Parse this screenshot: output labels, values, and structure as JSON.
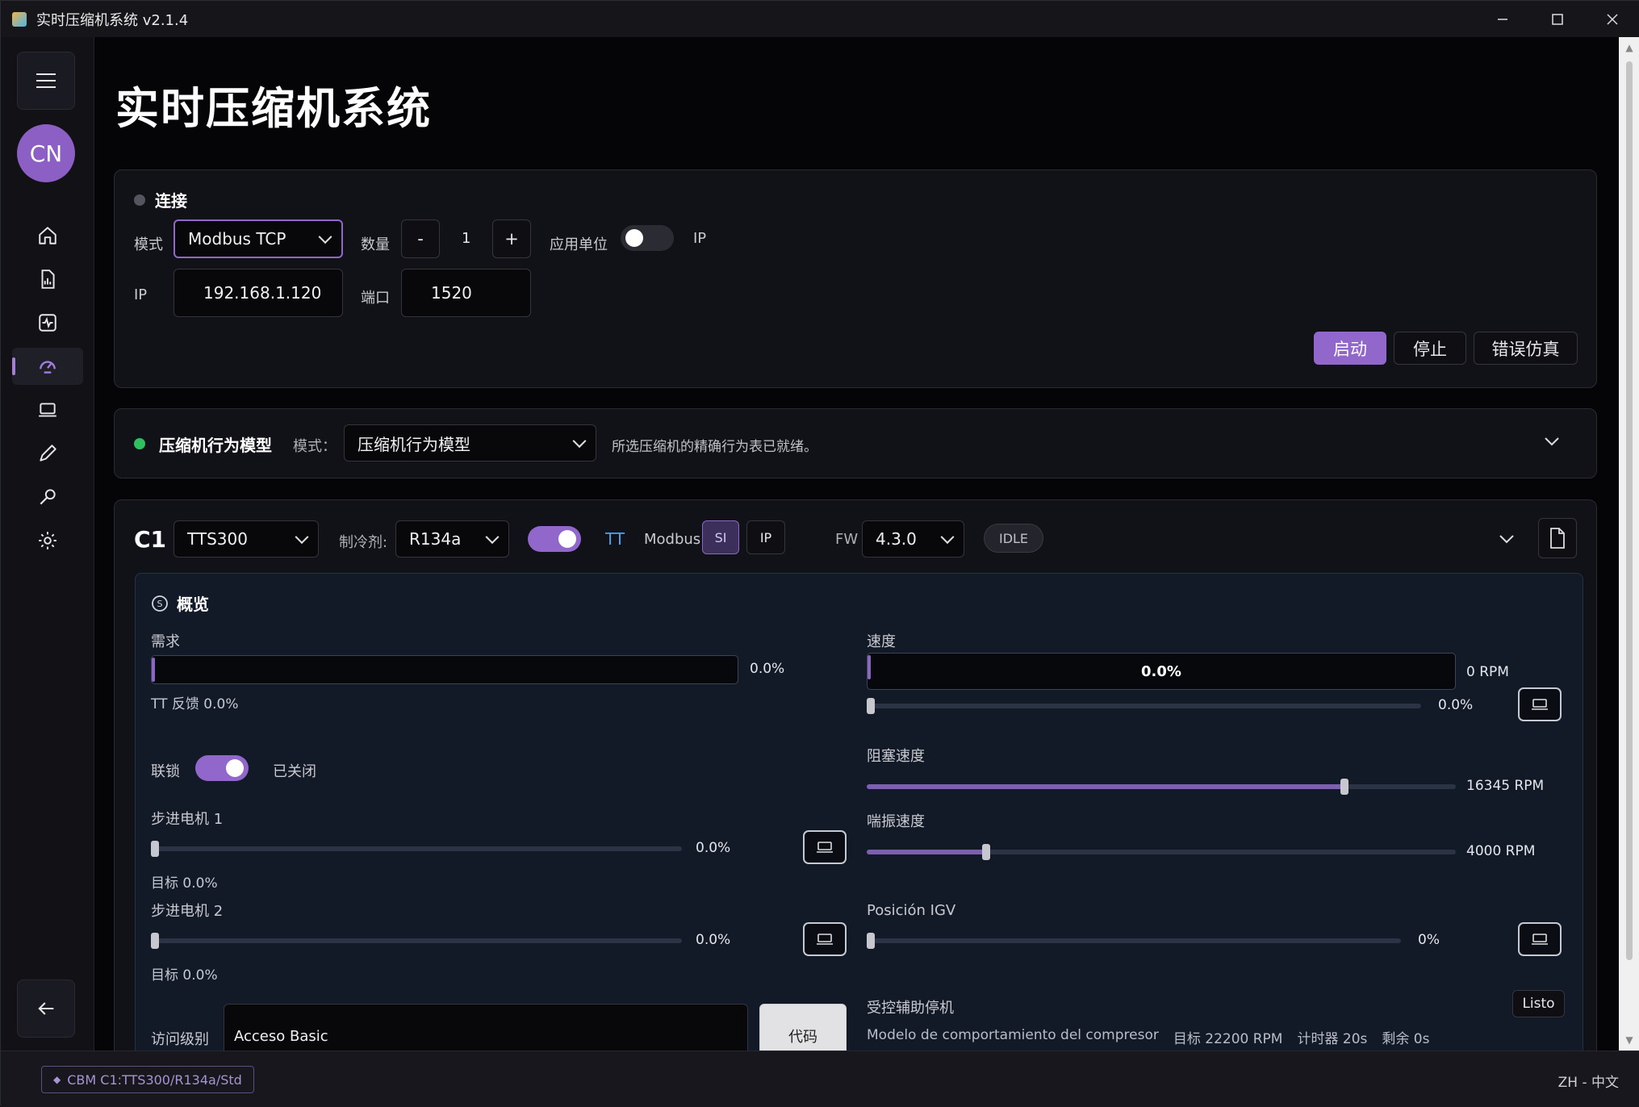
{
  "window": {
    "title": "实时压缩机系统 v2.1.4",
    "minimize": "—",
    "maximize": "☐",
    "close": "✕"
  },
  "sidebar": {
    "avatar_initials": "CN"
  },
  "page_title": "实时压缩机系统",
  "connection": {
    "header": "连接",
    "mode_label": "模式",
    "mode_value": "Modbus TCP",
    "count_label": "数量",
    "count_minus": "-",
    "count_value": "1",
    "count_plus": "+",
    "apply_unit_label": "应用单位",
    "ip_toggle_label": "IP",
    "ip_label": "IP",
    "ip_value": "192.168.1.120",
    "port_label": "端口",
    "port_value": "1520",
    "start": "启动",
    "stop": "停止",
    "error_sim": "错误仿真"
  },
  "behavior": {
    "header": "压缩机行为模型",
    "mode_label": "模式：",
    "mode_value": "压缩机行为模型",
    "status": "所选压缩机的精确行为表已就绪。"
  },
  "c1": {
    "id": "C1",
    "model": "TTS300",
    "refrigerant_label": "制冷剂:",
    "refrigerant": "R134a",
    "tt_label": "TT",
    "modbus_label": "Modbus",
    "si": "SI",
    "ip": "IP",
    "fw_label": "FW",
    "fw": "4.3.0",
    "state": "IDLE"
  },
  "overview": {
    "header": "概览",
    "demand_label": "需求",
    "demand_value": "0.0%",
    "demand_fraction": 0.0,
    "tt_feedback": "TT 反馈 0.0%",
    "speed_label": "速度",
    "speed_bar_text": "0.0%",
    "speed_rpm": "0 RPM",
    "speed_slider_value": "0.0%",
    "speed_slider_fraction": 0.0,
    "interlock_label": "联锁",
    "interlock_state": "已关闭",
    "choke_label": "阻塞速度",
    "choke_value": "16345 RPM",
    "choke_fraction": 0.82,
    "surge_label": "喘振速度",
    "surge_value": "4000 RPM",
    "surge_fraction": 0.2,
    "stepper1_label": "步进电机 1",
    "stepper1_value": "0.0%",
    "stepper1_target": "目标 0.0%",
    "stepper2_label": "步进电机 2",
    "stepper2_value": "0.0%",
    "stepper2_target": "目标 0.0%",
    "igv_label": "Posición IGV",
    "igv_value": "0%",
    "access_label": "访问级别",
    "access_value": "Acceso Basic",
    "code_button": "代码",
    "aux_stop_label": "受控辅助停机",
    "aux_ready": "Listo",
    "aux_model": "Modelo de comportamiento del compresor",
    "aux_target": "目标 22200 RPM",
    "aux_timer": "计时器 20s",
    "aux_remaining": "剩余 0s"
  },
  "statusbar": {
    "chip": "CBM C1:TTS300/R134a/Std",
    "lang": "ZH - 中文"
  },
  "colors": {
    "accent": "#9167cc",
    "ok": "#2fbf5f",
    "idle_dot": "#555560"
  }
}
